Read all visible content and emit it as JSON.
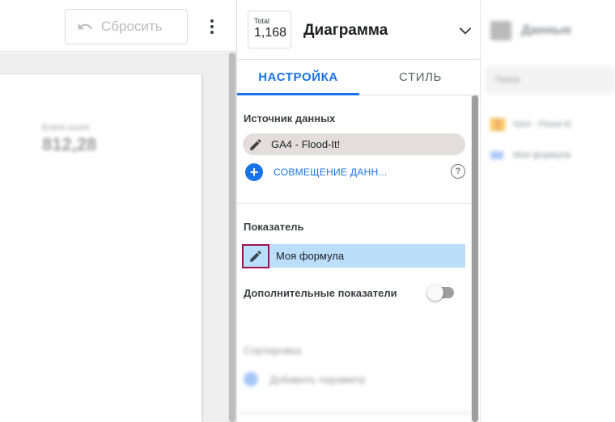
{
  "toolbar": {
    "reset_label": "Сбросить"
  },
  "canvas": {
    "scorecard_label": "Event count",
    "scorecard_value": "812,28"
  },
  "chart": {
    "thumb_label": "Total",
    "thumb_value": "1,168",
    "title": "Диаграмма"
  },
  "tabs": [
    {
      "label": "НАСТРОЙКА",
      "active": true
    },
    {
      "label": "СТИЛЬ",
      "active": false
    }
  ],
  "data_source": {
    "section_title": "Источник данных",
    "source_name": "GA4 - Flood-It!",
    "blend_label": "СОВМЕЩЕНИЕ ДАНН...",
    "help_glyph": "?"
  },
  "metric": {
    "section_title": "Показатель",
    "value": "Моя формула",
    "optional_label": "Дополнительные показатели",
    "optional_enabled": false
  },
  "sort": {
    "section_title": "Сортировка",
    "add_label": "Добавить параметр"
  },
  "data_panel": {
    "title": "Данные",
    "search_placeholder": "Поиск",
    "items": [
      {
        "label": "GA4 - Flood-It!"
      },
      {
        "label": "Моя формула"
      }
    ]
  },
  "colors": {
    "accent": "#1a73e8",
    "chip_source": "#e3dedc",
    "chip_metric": "#bbdefb",
    "highlight_border": "#a0144f"
  }
}
